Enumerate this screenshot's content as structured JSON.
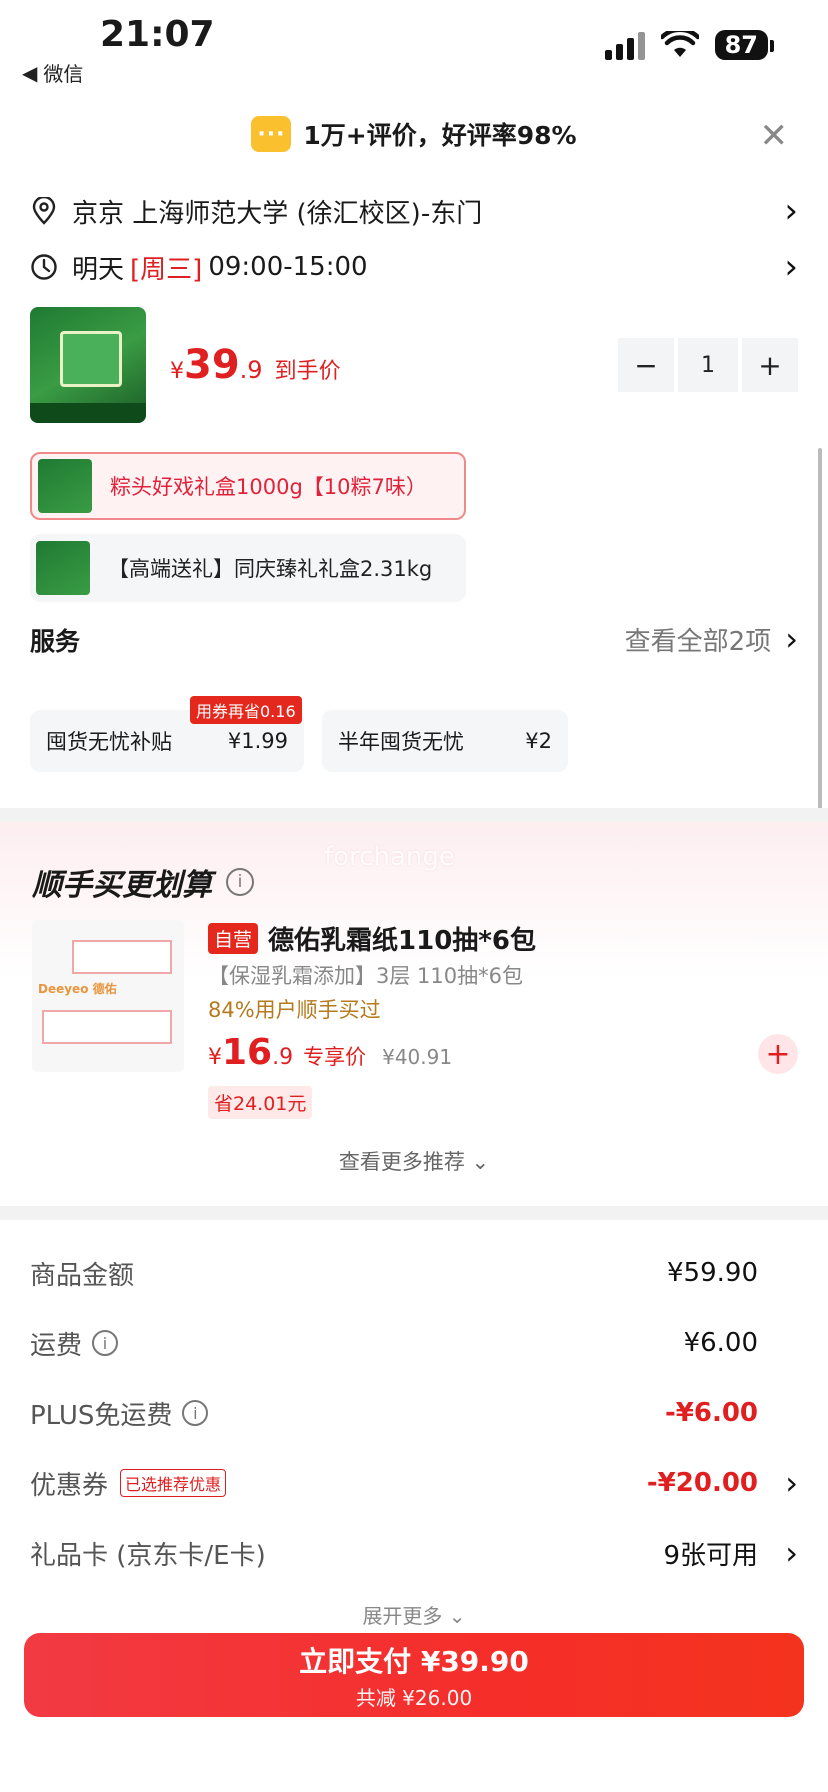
{
  "status": {
    "time": "21:07",
    "back_label": "微信",
    "battery": "87"
  },
  "review_banner": {
    "icon": "chat-dots-icon",
    "text": "1万+评价，好评率98%"
  },
  "address": {
    "text": "京京  上海师范大学 (徐汇校区)-东门"
  },
  "delivery": {
    "day": "明天",
    "weekday": "[周三]",
    "time_window": "09:00-15:00"
  },
  "product": {
    "price_currency": "¥",
    "price_int": "39",
    "price_dec": ".9",
    "price_tag": "到手价",
    "quantity": "1",
    "minus": "−",
    "plus": "+"
  },
  "variants": [
    {
      "label": "粽头好戏礼盒1000g【10粽7味）",
      "selected": true
    },
    {
      "label": "【高端送礼】同庆臻礼礼盒2.31kg",
      "selected": false
    }
  ],
  "services": {
    "title": "服务",
    "link": "查看全部2项",
    "badge": "用券再省0.16",
    "cards": [
      {
        "name": "囤货无忧补贴",
        "price": "¥1.99"
      },
      {
        "name": "半年囤货无忧",
        "price": "¥2"
      }
    ]
  },
  "recommend": {
    "title": "顺手买更划算",
    "watermark": "forchange",
    "image_label": "Deeyeo 德佑",
    "self_badge": "自营",
    "name": "德佑乳霜纸110抽*6包",
    "subtitle": "【保湿乳霜添加】3层 110抽*6包",
    "bought": "84%用户顺手买过",
    "price_currency": "¥",
    "price_int": "16",
    "price_dec": ".9",
    "exclusive": "专享价",
    "original": "¥40.91",
    "save": "省24.01元",
    "see_more": "查看更多推荐 ⌄"
  },
  "summary": {
    "goods_label": "商品金额",
    "goods_value": "¥59.90",
    "shipping_label": "运费",
    "shipping_value": "¥6.00",
    "plus_label": "PLUS免运费",
    "plus_value": "-¥6.00",
    "coupon_label": "优惠券",
    "coupon_tag": "已选推荐优惠",
    "coupon_value": "-¥20.00",
    "gift_label": "礼品卡 (京东卡/E卡)",
    "gift_value": "9张可用",
    "expand": "展开更多 ⌄"
  },
  "pay": {
    "main": "立即支付 ¥39.90",
    "sub": "共减 ¥26.00"
  },
  "colors": {
    "accent_red": "#e02020",
    "pay_gradient_start": "#f23a43",
    "pay_gradient_end": "#f4331d",
    "coupon_yellow": "#fbc02d"
  }
}
